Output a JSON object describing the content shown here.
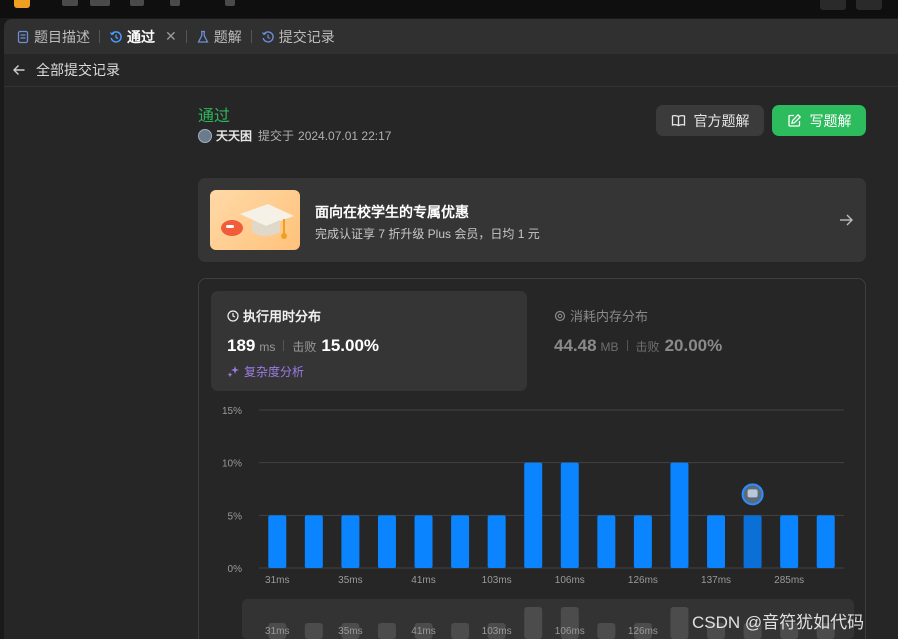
{
  "tabs": [
    {
      "label": "题目描述",
      "icon": "description-icon"
    },
    {
      "label": "通过",
      "icon": "history-icon",
      "active": true
    },
    {
      "label": "题解",
      "icon": "flask-icon"
    },
    {
      "label": "提交记录",
      "icon": "history-icon"
    }
  ],
  "back": {
    "label": "全部提交记录"
  },
  "submission": {
    "status": "通过",
    "username": "天天困",
    "submitted_prefix": "提交于",
    "time": "2024.07.01 22:17"
  },
  "buttons": {
    "official": "官方题解",
    "write": "写题解"
  },
  "promo": {
    "title": "面向在校学生的专属优惠",
    "subtitle": "完成认证享 7 折升级 Plus 会员，日均 1 元"
  },
  "runtime": {
    "title": "执行用时分布",
    "value": "189",
    "unit": "ms",
    "beat_label": "击败",
    "beat": "15.00%",
    "complexity": "复杂度分析"
  },
  "memory": {
    "title": "消耗内存分布",
    "value": "44.48",
    "unit": "MB",
    "beat_label": "击败",
    "beat": "20.00%"
  },
  "colors": {
    "accent": "#2cbb5d",
    "bar": "#0a84ff",
    "bar_user": "#0a6fd6"
  },
  "watermark": "CSDN @音符犹如代码",
  "chart_data": {
    "type": "bar",
    "ylim": [
      0,
      15
    ],
    "y_ticks": [
      "0%",
      "5%",
      "10%",
      "15%"
    ],
    "values": [
      5,
      5,
      5,
      5,
      5,
      5,
      5,
      10,
      10,
      5,
      5,
      10,
      5,
      5,
      5,
      5
    ],
    "x_labels": [
      "31ms",
      "35ms",
      "41ms",
      "103ms",
      "106ms",
      "126ms",
      "137ms",
      "285ms"
    ],
    "x_label_positions": [
      0,
      2,
      4,
      6,
      8,
      10,
      12,
      14
    ],
    "user_bar_index": 13,
    "grid": true,
    "navigator": {
      "values": [
        5,
        5,
        5,
        5,
        5,
        5,
        5,
        10,
        10,
        5,
        5,
        10,
        5,
        5,
        5,
        5
      ],
      "labels": [
        "31ms",
        "35ms",
        "41ms",
        "103ms",
        "106ms",
        "126ms"
      ],
      "label_positions": [
        0,
        2,
        4,
        6,
        8,
        10
      ]
    }
  }
}
